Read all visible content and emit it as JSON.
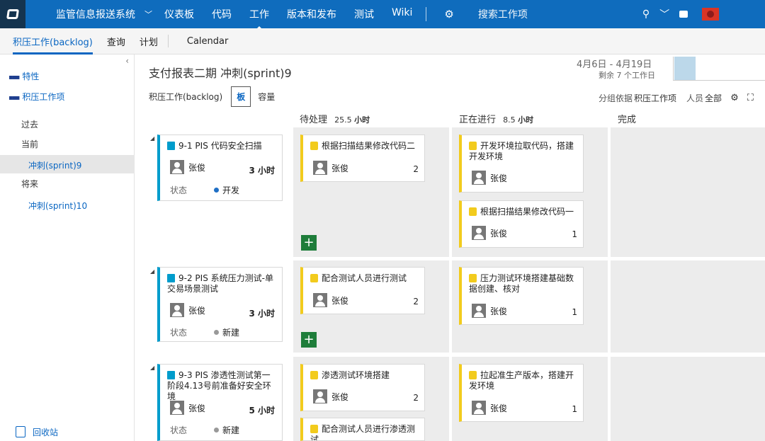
{
  "topbar": {
    "project": "监管信息报送系统",
    "nav": [
      "仪表板",
      "代码",
      "工作",
      "版本和发布",
      "测试",
      "Wiki"
    ],
    "active_nav": "工作",
    "search_placeholder": "搜索工作项",
    "brand_color": "#0f6cbd"
  },
  "subnav": [
    "积压工作(backlog)",
    "查询",
    "计划",
    "Calendar"
  ],
  "sidebar": {
    "features": "特性",
    "backlog_items": "积压工作项",
    "past": "过去",
    "current": "当前",
    "current_sprint": "冲刺(sprint)9",
    "future": "将来",
    "future_sprint": "冲刺(sprint)10",
    "recycle": "回收站"
  },
  "header": {
    "title": "支付报表二期 冲刺(sprint)9",
    "date_range": "4月6日 - 4月19日",
    "remaining": "剩余 7 个工作日",
    "view_backlog": "积压工作(backlog)",
    "view_board": "板",
    "view_capacity": "容量",
    "group_by_label": "分组依据",
    "group_by_value": "积压工作项",
    "person_label": "人员",
    "person_value": "全部"
  },
  "columns": {
    "todo": {
      "name": "待处理",
      "hours": "25.5",
      "unit": "小时"
    },
    "inprogress": {
      "name": "正在进行",
      "hours": "8.5",
      "unit": "小时"
    },
    "done": {
      "name": "完成"
    }
  },
  "rows": [
    {
      "pbi": {
        "title": "9-1 PIS 代码安全扫描",
        "assignee": "张俊",
        "hours": "3",
        "unit": "小时",
        "state_label": "状态",
        "state": "开发",
        "state_color": "#1f6fc5"
      },
      "todo": [
        {
          "title": "根据扫描结果修改代码二",
          "assignee": "张俊",
          "remaining": "2"
        }
      ],
      "inprogress": [
        {
          "title": "开发环境拉取代码，搭建开发环境",
          "assignee": "张俊",
          "remaining": ""
        },
        {
          "title": "根据扫描结果修改代码一",
          "assignee": "张俊",
          "remaining": "1"
        }
      ]
    },
    {
      "pbi": {
        "title": "9-2 PIS 系统压力测试-单交易场景测试",
        "assignee": "张俊",
        "hours": "3",
        "unit": "小时",
        "state_label": "状态",
        "state": "新建",
        "state_color": "#999999"
      },
      "todo": [
        {
          "title": "配合测试人员进行测试",
          "assignee": "张俊",
          "remaining": "2"
        }
      ],
      "inprogress": [
        {
          "title": "压力测试环境搭建基础数据创建、核对",
          "assignee": "张俊",
          "remaining": "1"
        }
      ]
    },
    {
      "pbi": {
        "title": "9-3 PIS 渗透性测试第一阶段4.13号前准备好安全环境",
        "assignee": "张俊",
        "hours": "5",
        "unit": "小时",
        "state_label": "状态",
        "state": "新建",
        "state_color": "#999999"
      },
      "todo": [
        {
          "title": "渗透测试环境搭建",
          "assignee": "张俊",
          "remaining": "2"
        },
        {
          "title": "配合测试人员进行渗透测试",
          "assignee": "",
          "remaining": ""
        }
      ],
      "inprogress": [
        {
          "title": "拉起准生产版本，搭建开发环境",
          "assignee": "张俊",
          "remaining": "1"
        }
      ]
    }
  ]
}
